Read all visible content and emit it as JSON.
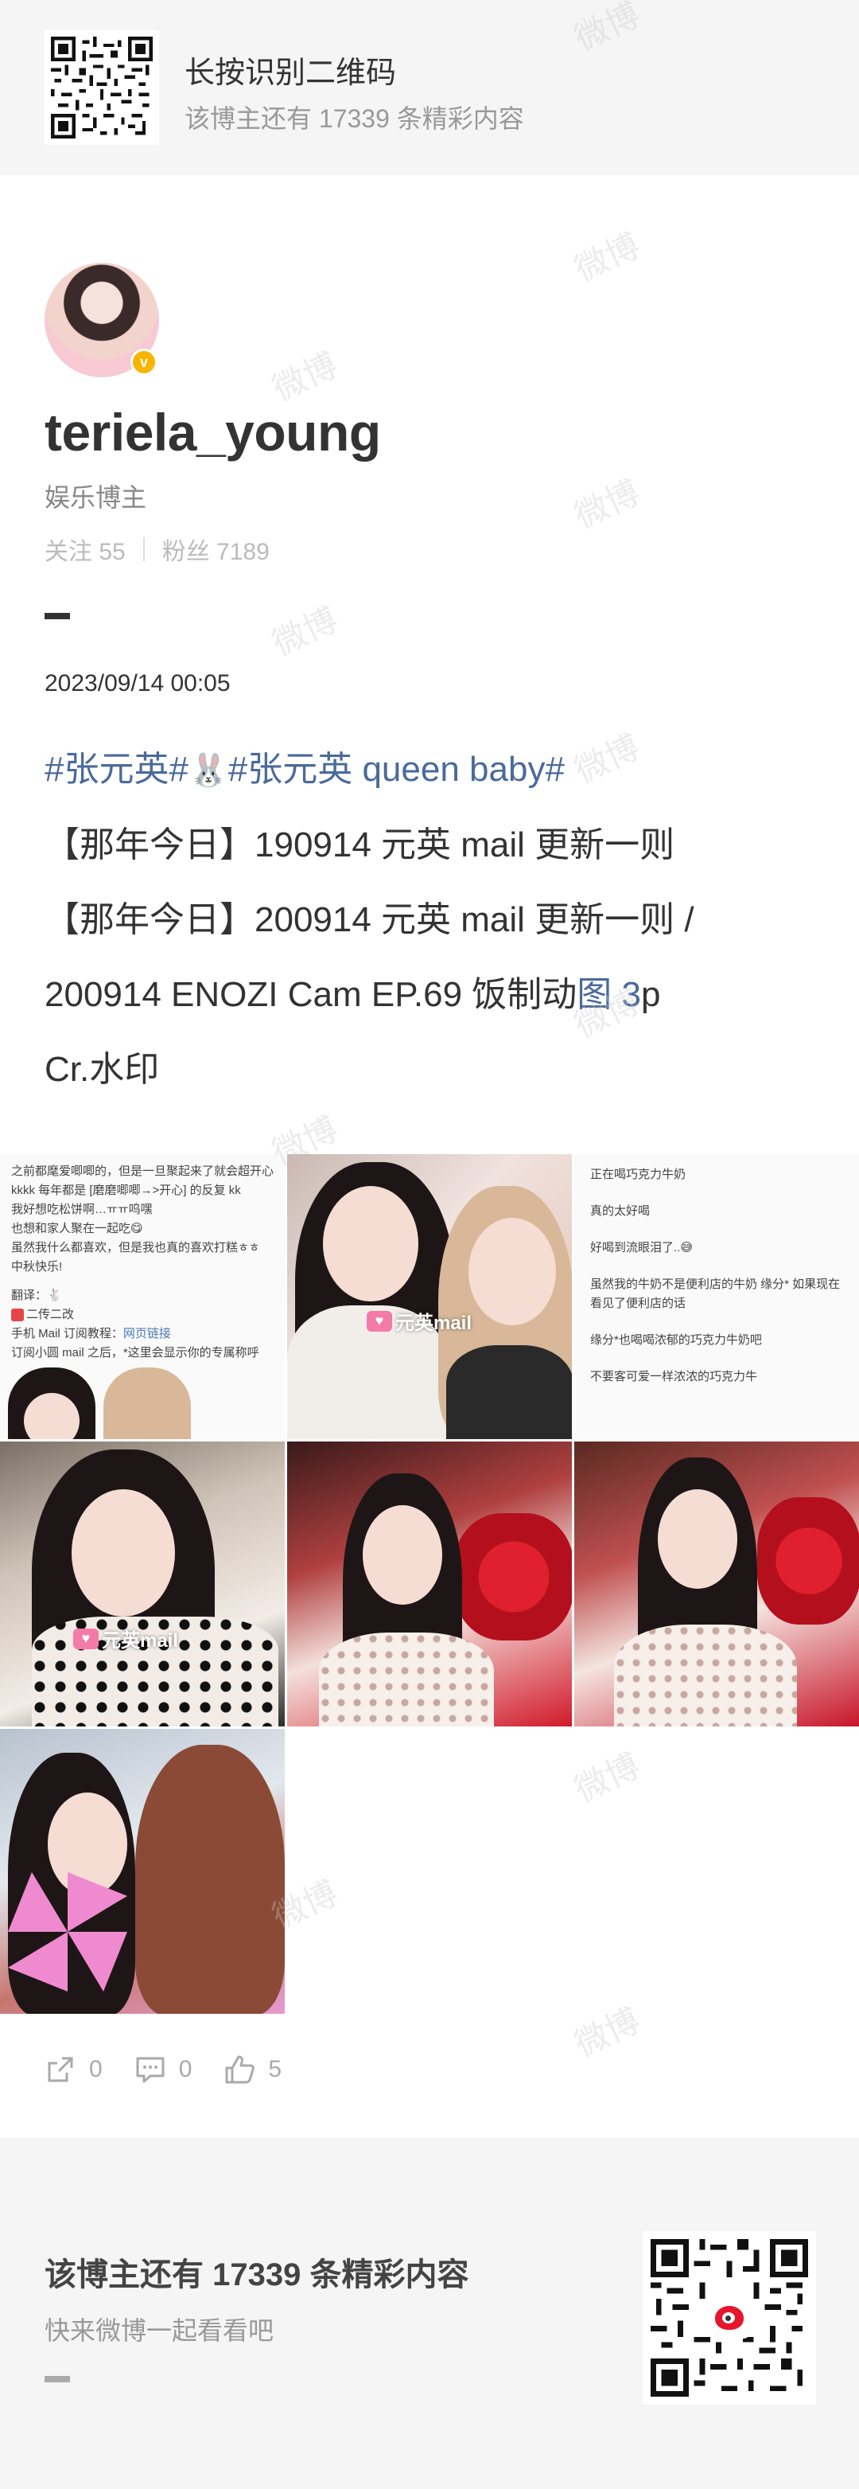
{
  "qr_prompt": {
    "title": "长按识别二维码",
    "subtitle": "该博主还有 17339 条精彩内容"
  },
  "profile": {
    "username": "teriela_young",
    "role": "娱乐博主",
    "following_label": "关注 55",
    "followers_label": "粉丝 7189",
    "verified_icon": "verified-badge-icon",
    "verified_color": "#f7b500"
  },
  "post": {
    "date": "2023/09/14 00:05",
    "hashtag_1": "#张元英#",
    "emoji": "🐰",
    "hashtag_2": "#张元英 queen baby#",
    "line_2": "【那年今日】190914 元英 mail 更新一则",
    "line_3": "【那年今日】200914 元英 mail 更新一则 /",
    "line_4_prefix": "200914 ENOZI Cam EP.69 饭制动",
    "line_4_link": "图 3",
    "line_4_suffix": "p",
    "line_5": "Cr.水印",
    "hashtag_color": "#4a6a9b"
  },
  "images": {
    "mail_label": "元英mail",
    "mail_label_2": "元英mail",
    "tile1_lines": [
      "之前都麾爱唧唧的，但是一旦聚起来了就会超开心",
      "kkkk 每年都是 [磨磨唧唧→>开心] 的反复 kk",
      "我好想吃松饼啊…ㅠㅠ呜嘿",
      "也想和家人聚在一起吃😋",
      "虽然我什么都喜欢，但是我也真的喜欢打糕ㅎㅎ",
      "中秋快乐!"
    ],
    "tile1_translate": "翻译：🐇",
    "tile1_repost": "二传二改",
    "tile1_tutorial_label": "手机 Mail 订阅教程：",
    "tile1_tutorial_link": "网页链接",
    "tile1_subscribe": "订阅小圆 mail 之后，*这里会显示你的专属称呼",
    "tile3_lines": [
      "正在喝巧克力牛奶",
      "真的太好喝",
      "好喝到流眼泪了..😅",
      "虽然我的牛奶不是便利店的牛奶 缘分* 如果现在看见了便利店的话",
      "缘分*也喝喝浓郁的巧克力牛奶吧",
      "不要客可爱一样浓浓的巧克力牛"
    ]
  },
  "actions": {
    "repost_count": "0",
    "comment_count": "0",
    "like_count": "5"
  },
  "promo": {
    "title": "该博主还有 17339 条精彩内容",
    "subtitle": "快来微博一起看看吧",
    "brand_color": "#e6162d"
  },
  "watermark_text": "微博"
}
